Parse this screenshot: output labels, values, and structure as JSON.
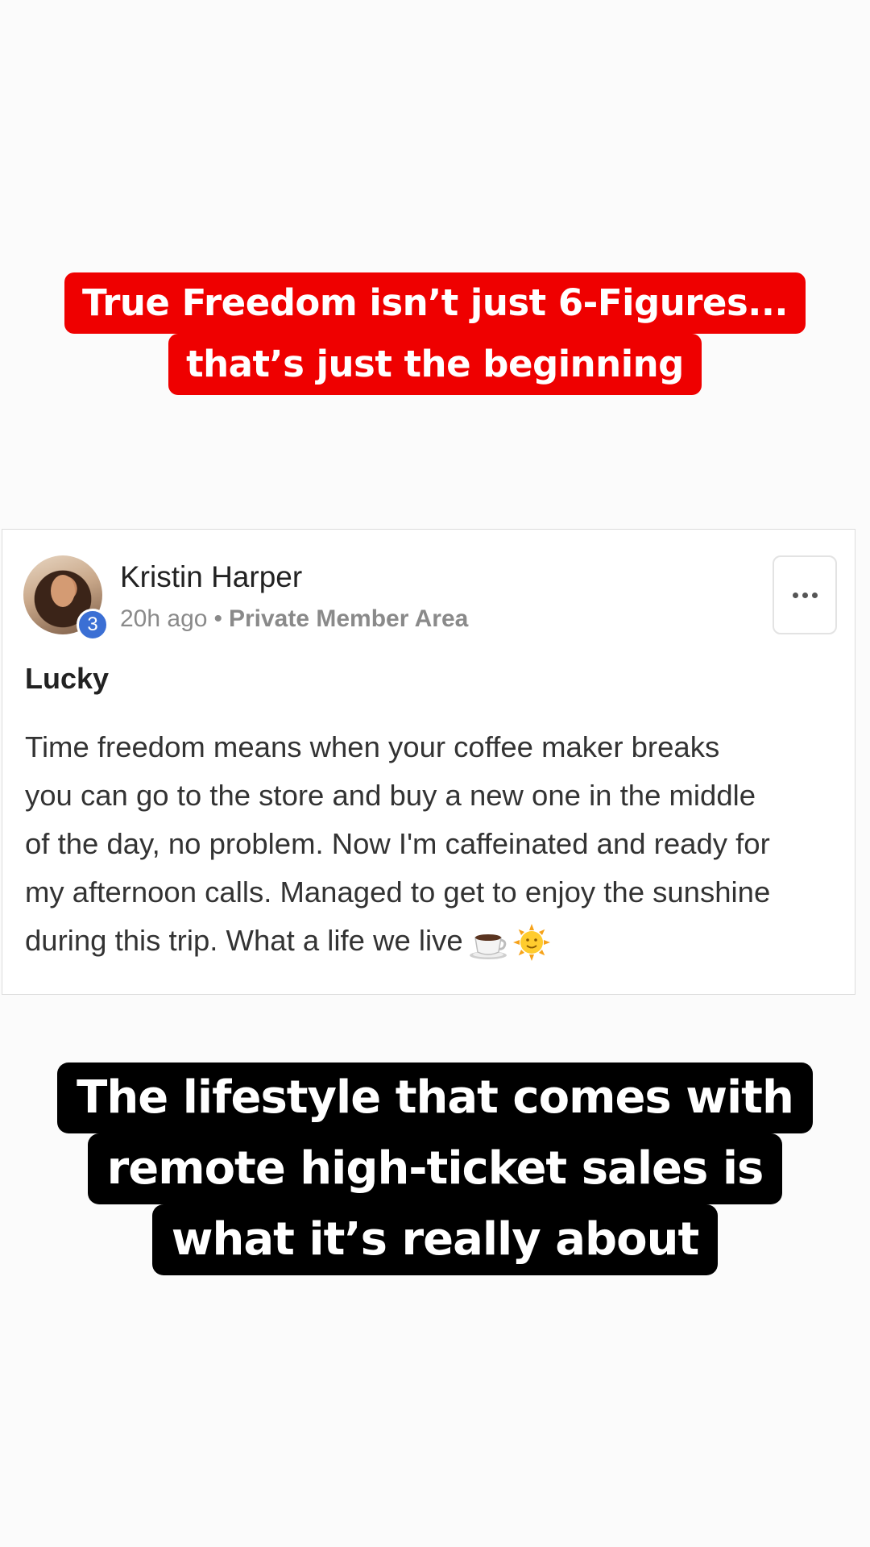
{
  "top_caption": {
    "line1": "True Freedom isn’t just 6-Figures...",
    "line2": "that’s just the beginning",
    "background": "#ef0000"
  },
  "post": {
    "author": "Kristin Harper",
    "level": "3",
    "time": "20h ago",
    "separator": "•",
    "group": "Private Member Area",
    "title": "Lucky",
    "body_lines": [
      "Time freedom means when your coffee maker breaks",
      "you can go to the store and buy a new one in the middle",
      "of the day, no problem. Now I'm caffeinated and ready for",
      "my afternoon calls. Managed to get to enjoy the sunshine",
      "during this trip. What a life we live"
    ],
    "emojis": [
      "coffee-icon",
      "sun-icon"
    ],
    "level_badge_color": "#3b6fd4"
  },
  "bottom_caption": {
    "line1": "The lifestyle that comes with",
    "line2": "remote high-ticket sales is",
    "line3": "what it’s really about",
    "background": "#000000"
  }
}
